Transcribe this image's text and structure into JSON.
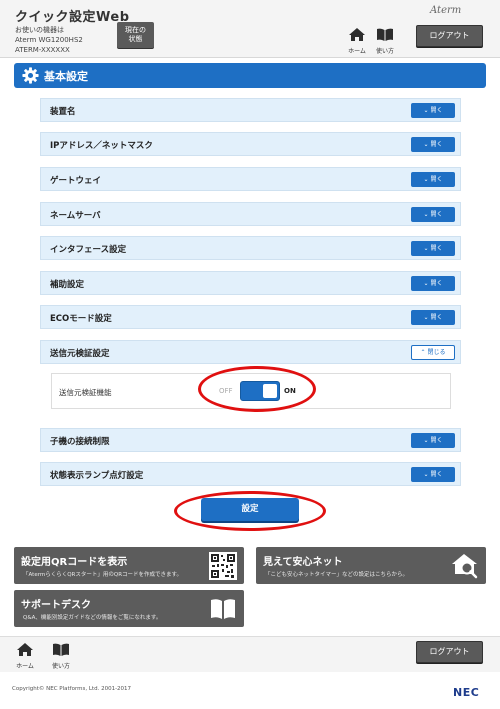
{
  "header": {
    "title": "クイック設定Web",
    "device_caption": "お使いの機器は",
    "model": "Aterm WG1200HS2",
    "serial": "ATERM-XXXXXX",
    "status_button": "現在の\n状態",
    "logo": "Aterm",
    "home_label": "ホーム",
    "help_label": "使い方",
    "logout_label": "ログアウト"
  },
  "section": {
    "title": "基本設定"
  },
  "settings": {
    "open_label": "開く",
    "close_label": "閉じる",
    "items": [
      {
        "label": "装置名",
        "state": "collapsed"
      },
      {
        "label": "IPアドレス／ネットマスク",
        "state": "collapsed"
      },
      {
        "label": "ゲートウェイ",
        "state": "collapsed"
      },
      {
        "label": "ネームサーバ",
        "state": "collapsed"
      },
      {
        "label": "インタフェース設定",
        "state": "collapsed"
      },
      {
        "label": "補助設定",
        "state": "collapsed"
      },
      {
        "label": "ECOモード設定",
        "state": "collapsed"
      },
      {
        "label": "送信元検証設定",
        "state": "expanded"
      },
      {
        "label": "子機の接続制限",
        "state": "collapsed"
      },
      {
        "label": "状態表示ランプ点灯設定",
        "state": "collapsed"
      }
    ],
    "source_validation": {
      "label": "送信元検証機能",
      "off_label": "OFF",
      "on_label": "ON",
      "value": "ON"
    },
    "submit_label": "設定"
  },
  "cards": {
    "qr": {
      "title": "設定用QRコードを表示",
      "subtitle": "「AtermらくらくQRスタート」用のQRコードを作成できます。"
    },
    "mieru": {
      "title": "見えて安心ネット",
      "subtitle": "「こども安心ネットタイマー」などの設定はこちらから。"
    },
    "support": {
      "title": "サポートデスク",
      "subtitle": "Q&A、機能別設定ガイドなどの情報をご覧になれます。"
    }
  },
  "footer": {
    "home_label": "ホーム",
    "help_label": "使い方",
    "logout_label": "ログアウト",
    "copyright": "Copyright© NEC Platforms, Ltd. 2001-2017",
    "brand": "NEC"
  },
  "colors": {
    "accent": "#1e6fc4",
    "row_bg": "#e2f0fb",
    "card_bg": "#5c5c5c",
    "highlight": "#e01010"
  },
  "icons": [
    "home-icon",
    "book-icon",
    "gear-icon",
    "chevron-down-icon",
    "chevron-up-icon",
    "qr-code-icon",
    "house-search-icon"
  ]
}
